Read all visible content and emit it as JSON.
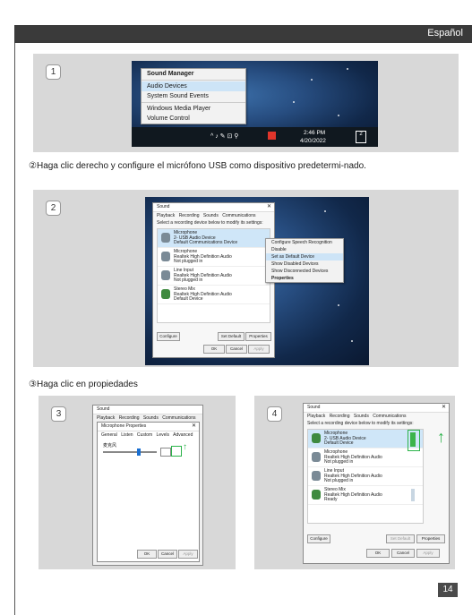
{
  "header": {
    "language": "Español"
  },
  "step1": {
    "number": "1",
    "menu": [
      "Sound Manager",
      "Audio Devices",
      "System Sound Events",
      "Windows Media Player",
      "Volume Control"
    ],
    "taskbar": {
      "time": "2:46 PM",
      "date": "4/20/2022",
      "badge": "2"
    }
  },
  "step2": {
    "instruction_marker": "②",
    "instruction": "Haga clic derecho y configure el micrófono USB como dispositivo predetermi-nado.",
    "number": "2",
    "dialog": {
      "title": "Sound",
      "tabs": [
        "Playback",
        "Recording",
        "Sounds",
        "Communications"
      ],
      "subtitle": "Select a recording device below to modify its settings:",
      "devices": [
        {
          "name": "Microphone",
          "line2": "2- USB Audio Device",
          "line3": "Default Communications Device"
        },
        {
          "name": "Microphone",
          "line2": "Realtek High Definition Audio",
          "line3": "Not plugged in"
        },
        {
          "name": "Line Input",
          "line2": "Realtek High Definition Audio",
          "line3": "Not plugged in"
        },
        {
          "name": "Stereo Mix",
          "line2": "Realtek High Definition Audio",
          "line3": "Default Device"
        }
      ],
      "buttons": {
        "configure": "Configure",
        "set_default": "Set Default",
        "properties": "Properties",
        "ok": "OK",
        "cancel": "Cancel",
        "apply": "Apply"
      }
    },
    "context_menu": [
      "Configure Speech Recognition",
      "Disable",
      "Set as Default Device",
      "Show Disabled Devices",
      "Show Disconnected Devices",
      "Properties"
    ]
  },
  "step3": {
    "instruction_marker": "③",
    "instruction": "Haga clic en propiedades",
    "number": "3",
    "dialog": {
      "title": "Sound",
      "tabs": [
        "Playback",
        "Recording",
        "Sounds",
        "Communications"
      ],
      "props_title": "Microphone Properties",
      "props_tabs": [
        "General",
        "Listen",
        "Custom",
        "Levels",
        "Advanced"
      ],
      "level_label": "麦克风",
      "buttons": {
        "ok": "OK",
        "cancel": "Cancel",
        "apply": "Apply"
      }
    }
  },
  "step4": {
    "number": "4",
    "dialog": {
      "title": "Sound",
      "tabs": [
        "Playback",
        "Recording",
        "Sounds",
        "Communications"
      ],
      "subtitle": "Select a recording device below to modify its settings:",
      "devices": [
        {
          "name": "Microphone",
          "line2": "2- USB Audio Device",
          "line3": "Default Device"
        },
        {
          "name": "Microphone",
          "line2": "Realtek High Definition Audio",
          "line3": "Not plugged in"
        },
        {
          "name": "Line Input",
          "line2": "Realtek High Definition Audio",
          "line3": "Not plugged in"
        },
        {
          "name": "Stereo Mix",
          "line2": "Realtek High Definition Audio",
          "line3": "Ready"
        }
      ],
      "buttons": {
        "configure": "Configure",
        "set_default": "Set Default",
        "properties": "Properties",
        "ok": "OK",
        "cancel": "Cancel",
        "apply": "Apply"
      }
    }
  },
  "page_number": "14",
  "colors": {
    "header_bg": "#3a3a3a",
    "panel_bg": "#d8d8d8",
    "highlight": "#2bb34a",
    "page_badge": "#4a4a4a"
  }
}
